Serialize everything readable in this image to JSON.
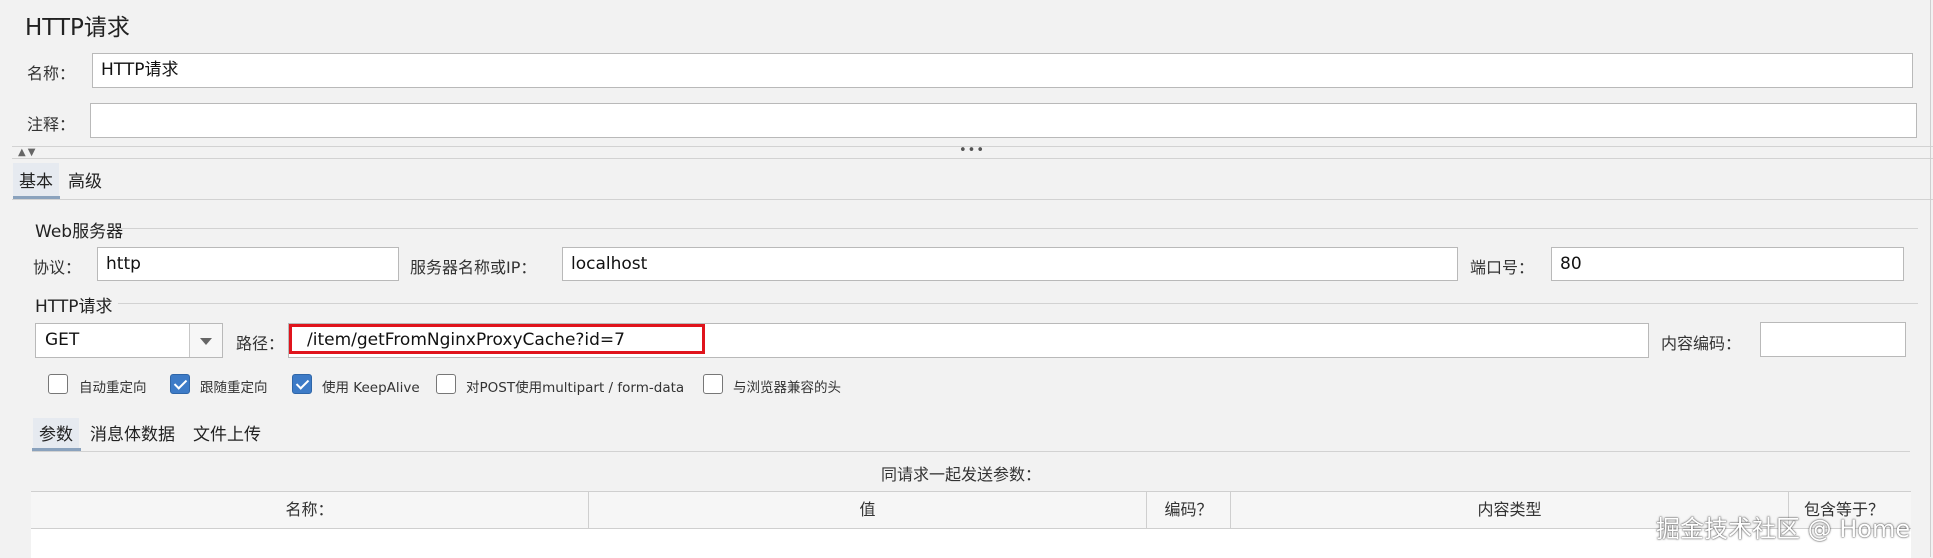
{
  "panel_title": "HTTP请求",
  "name_label": "名称：",
  "name_value": "HTTP请求",
  "comment_label": "注释：",
  "comment_value": "",
  "tabs": [
    {
      "label": "基本",
      "active": true
    },
    {
      "label": "高级",
      "active": false
    }
  ],
  "web_server": {
    "legend": "Web服务器",
    "protocol_label": "协议：",
    "protocol_value": "http",
    "server_label": "服务器名称或IP：",
    "server_value": "localhost",
    "port_label": "端口号：",
    "port_value": "80"
  },
  "http_request": {
    "legend": "HTTP请求",
    "method": "GET",
    "path_label": "路径：",
    "path_value": "/item/getFromNginxProxyCache?id=7",
    "encoding_label": "内容编码：",
    "encoding_value": ""
  },
  "options": [
    {
      "label": "自动重定向",
      "checked": false
    },
    {
      "label": "跟随重定向",
      "checked": true
    },
    {
      "label": "使用 KeepAlive",
      "checked": true
    },
    {
      "label": "对POST使用multipart / form-data",
      "checked": false
    },
    {
      "label": "与浏览器兼容的头",
      "checked": false
    }
  ],
  "sub_tabs": [
    {
      "label": "参数",
      "active": true
    },
    {
      "label": "消息体数据",
      "active": false
    },
    {
      "label": "文件上传",
      "active": false
    }
  ],
  "params_caption": "同请求一起发送参数：",
  "table_headers": [
    "名称：",
    "值",
    "编码？",
    "内容类型",
    "包含等于？"
  ],
  "watermark": "掘金技术社区 @ Home",
  "colors": {
    "highlight_border": "#e0141c",
    "checkbox_checked": "#3d7bc7",
    "background": "#f2f2f2"
  }
}
